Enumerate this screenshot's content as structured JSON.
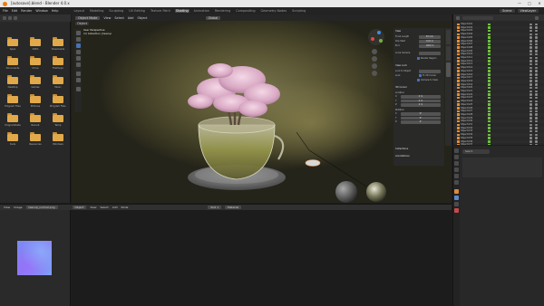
{
  "window": {
    "title": "[autosave].blend - Blender 4.0.x",
    "controls": [
      "—",
      "□",
      "✕"
    ]
  },
  "menus": [
    "File",
    "Edit",
    "Render",
    "Window",
    "Help"
  ],
  "workspaces": [
    "Layout",
    "Modeling",
    "Sculpting",
    "UV Editing",
    "Texture Paint",
    "Shading",
    "Animation",
    "Rendering",
    "Compositing",
    "Geometry Nodes",
    "Scripting"
  ],
  "active_workspace": "Shading",
  "scene": {
    "scene_label": "Scene",
    "view_layer_label": "ViewLayer"
  },
  "file_browser": {
    "folders": [
      "Apps",
      "DATA",
      "Downloads",
      "Documents",
      "Drive",
      "FileHippo",
      "Desktop",
      "Games",
      "Music",
      "Program Files",
      "Pictures",
      "Program Files (x86)",
      "ProgramData",
      "Recent",
      "Temp",
      "tools",
      "Resources",
      "Windows"
    ]
  },
  "viewport": {
    "header": [
      "Object",
      "View",
      "Select",
      "Add",
      "Object"
    ],
    "mode_label": "Object Mode",
    "overlay_line1": "User Perspective",
    "overlay_line2": "(1) Collection | teacup",
    "shading_label": "Global"
  },
  "n_panel": {
    "view_header": "View",
    "focal_length_label": "Focal Length",
    "focal_length": "50 mm",
    "clip_start_label": "Clip Start",
    "clip_start": "0.01 m",
    "clip_end_label": "End",
    "clip_end": "1000 m",
    "local_camera_label": "Local Camera",
    "render_region_label": "Render Region",
    "view_lock_header": "View Lock",
    "lock_to_object_label": "Lock to Object",
    "lock_label": "Lock",
    "to_3d_cursor_label": "To 3D Cursor",
    "camera_to_view_label": "Camera to View",
    "cursor_header": "3D Cursor",
    "location_label": "Location",
    "x": "0 m",
    "y": "0 m",
    "z": "0 m",
    "rotation_label": "Rotation",
    "rx": "0°",
    "ry": "0°",
    "rz": "0°",
    "collections_header": "Collections",
    "annotations_header": "Annotations"
  },
  "outliner": {
    "items": [
      "Object.001",
      "Object.002",
      "Object.003",
      "Object.004",
      "Object.005",
      "Object.006",
      "Object.007",
      "Object.008",
      "Object.009",
      "Object.010",
      "Object.011",
      "Object.012",
      "Object.013",
      "Object.014",
      "Object.015",
      "Object.016",
      "Object.017",
      "Object.018",
      "Object.019",
      "Object.020",
      "Object.021",
      "Object.022",
      "Object.023",
      "Object.024",
      "Object.025",
      "Object.026",
      "Object.027",
      "Object.028",
      "Object.029",
      "Object.030",
      "Object.031",
      "Object.032",
      "Object.033",
      "Object.034",
      "Object.035",
      "Object.036",
      "Object.037"
    ]
  },
  "properties": {
    "search_placeholder": "Search"
  },
  "shader_editor": {
    "header": [
      "Object",
      "View",
      "Select",
      "Add",
      "Node"
    ],
    "slot_label": "Slot 1",
    "material_label": "Material"
  },
  "image_editor": {
    "header": [
      "View",
      "Image"
    ],
    "image_name": "teacup_normal.png"
  }
}
